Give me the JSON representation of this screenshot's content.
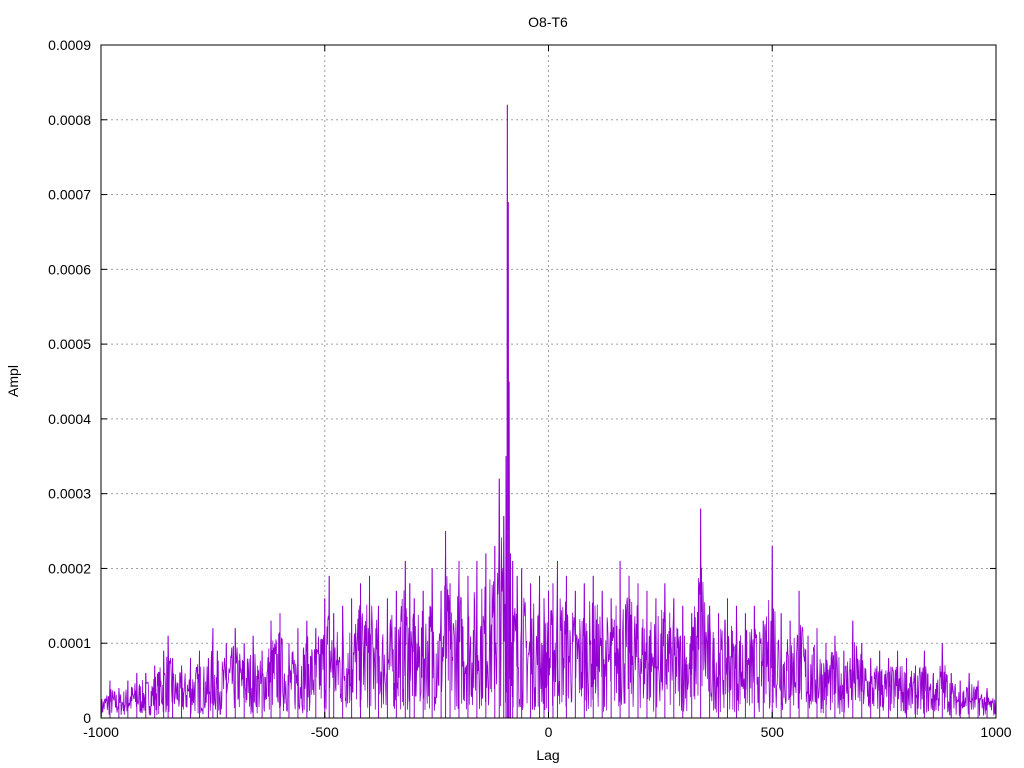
{
  "chart_data": {
    "type": "line",
    "title": "O8-T6",
    "xlabel": "Lag",
    "ylabel": "Ampl",
    "xlim": [
      -1000,
      1000
    ],
    "ylim": [
      0,
      0.0009
    ],
    "grid": true,
    "x_ticks": [
      {
        "value": -1000,
        "label": "-1000"
      },
      {
        "value": -500,
        "label": "-500"
      },
      {
        "value": 0,
        "label": "0"
      },
      {
        "value": 500,
        "label": "500"
      },
      {
        "value": 1000,
        "label": "1000"
      }
    ],
    "y_ticks": [
      {
        "value": 0,
        "label": "0"
      },
      {
        "value": 0.0001,
        "label": "0.0001"
      },
      {
        "value": 0.0002,
        "label": "0.0002"
      },
      {
        "value": 0.0003,
        "label": "0.0003"
      },
      {
        "value": 0.0004,
        "label": "0.0004"
      },
      {
        "value": 0.0005,
        "label": "0.0005"
      },
      {
        "value": 0.0006,
        "label": "0.0006"
      },
      {
        "value": 0.0007,
        "label": "0.0007"
      },
      {
        "value": 0.0008,
        "label": "0.0008"
      },
      {
        "value": 0.0009,
        "label": "0.0009"
      }
    ],
    "series": [
      {
        "color": "#9400d3",
        "x": [
          -1000,
          -980,
          -960,
          -940,
          -920,
          -900,
          -880,
          -860,
          -850,
          -840,
          -820,
          -800,
          -780,
          -760,
          -750,
          -740,
          -720,
          -700,
          -680,
          -660,
          -640,
          -620,
          -600,
          -580,
          -560,
          -540,
          -520,
          -500,
          -490,
          -480,
          -460,
          -440,
          -420,
          -400,
          -380,
          -360,
          -340,
          -320,
          -310,
          -300,
          -280,
          -260,
          -240,
          -230,
          -220,
          -200,
          -180,
          -160,
          -140,
          -120,
          -110,
          -100,
          -95,
          -92,
          -90,
          -88,
          -85,
          -80,
          -70,
          -60,
          -40,
          -20,
          -10,
          0,
          10,
          20,
          40,
          60,
          80,
          100,
          120,
          140,
          160,
          180,
          200,
          220,
          240,
          260,
          280,
          300,
          320,
          340,
          360,
          380,
          400,
          420,
          440,
          460,
          480,
          500,
          520,
          540,
          560,
          580,
          600,
          620,
          640,
          660,
          680,
          700,
          720,
          740,
          760,
          780,
          800,
          820,
          840,
          860,
          880,
          900,
          920,
          940,
          960,
          980,
          1000
        ],
        "y": [
          3e-05,
          5e-05,
          4e-05,
          5e-05,
          6e-05,
          6e-05,
          7e-05,
          9e-05,
          0.00011,
          8e-05,
          7e-05,
          8e-05,
          9e-05,
          8e-05,
          0.00012,
          9e-05,
          0.0001,
          0.00012,
          0.0001,
          0.00011,
          9e-05,
          0.00013,
          0.00014,
          0.0001,
          0.00012,
          0.00013,
          0.00012,
          0.00016,
          0.00019,
          0.00014,
          0.00015,
          0.00016,
          0.00018,
          0.00019,
          0.00015,
          0.00016,
          0.00017,
          0.00021,
          0.00018,
          0.00016,
          0.00017,
          0.0002,
          0.00017,
          0.00025,
          0.00018,
          0.00021,
          0.00019,
          0.00021,
          0.00022,
          0.00023,
          0.00032,
          0.00027,
          0.00035,
          0.00082,
          0.00069,
          0.00045,
          0.00022,
          0.00021,
          0.00019,
          0.0002,
          0.00018,
          0.00019,
          0.00016,
          0.00017,
          0.00018,
          0.00021,
          0.00019,
          0.00017,
          0.00018,
          0.00019,
          0.00017,
          0.00016,
          0.00021,
          0.00019,
          0.00018,
          0.00017,
          0.00016,
          0.00018,
          0.00016,
          0.00015,
          0.00014,
          0.00028,
          0.00015,
          0.00014,
          0.00016,
          0.00015,
          0.00014,
          0.00015,
          0.00013,
          0.00023,
          0.00014,
          0.00013,
          0.00017,
          0.00011,
          0.00012,
          0.0001,
          0.00011,
          9e-05,
          0.00013,
          0.0001,
          8e-05,
          9e-05,
          8e-05,
          9e-05,
          8e-05,
          7e-05,
          9e-05,
          6e-05,
          0.0001,
          6e-05,
          5e-05,
          6e-05,
          5e-05,
          4e-05,
          3e-05
        ]
      }
    ]
  }
}
